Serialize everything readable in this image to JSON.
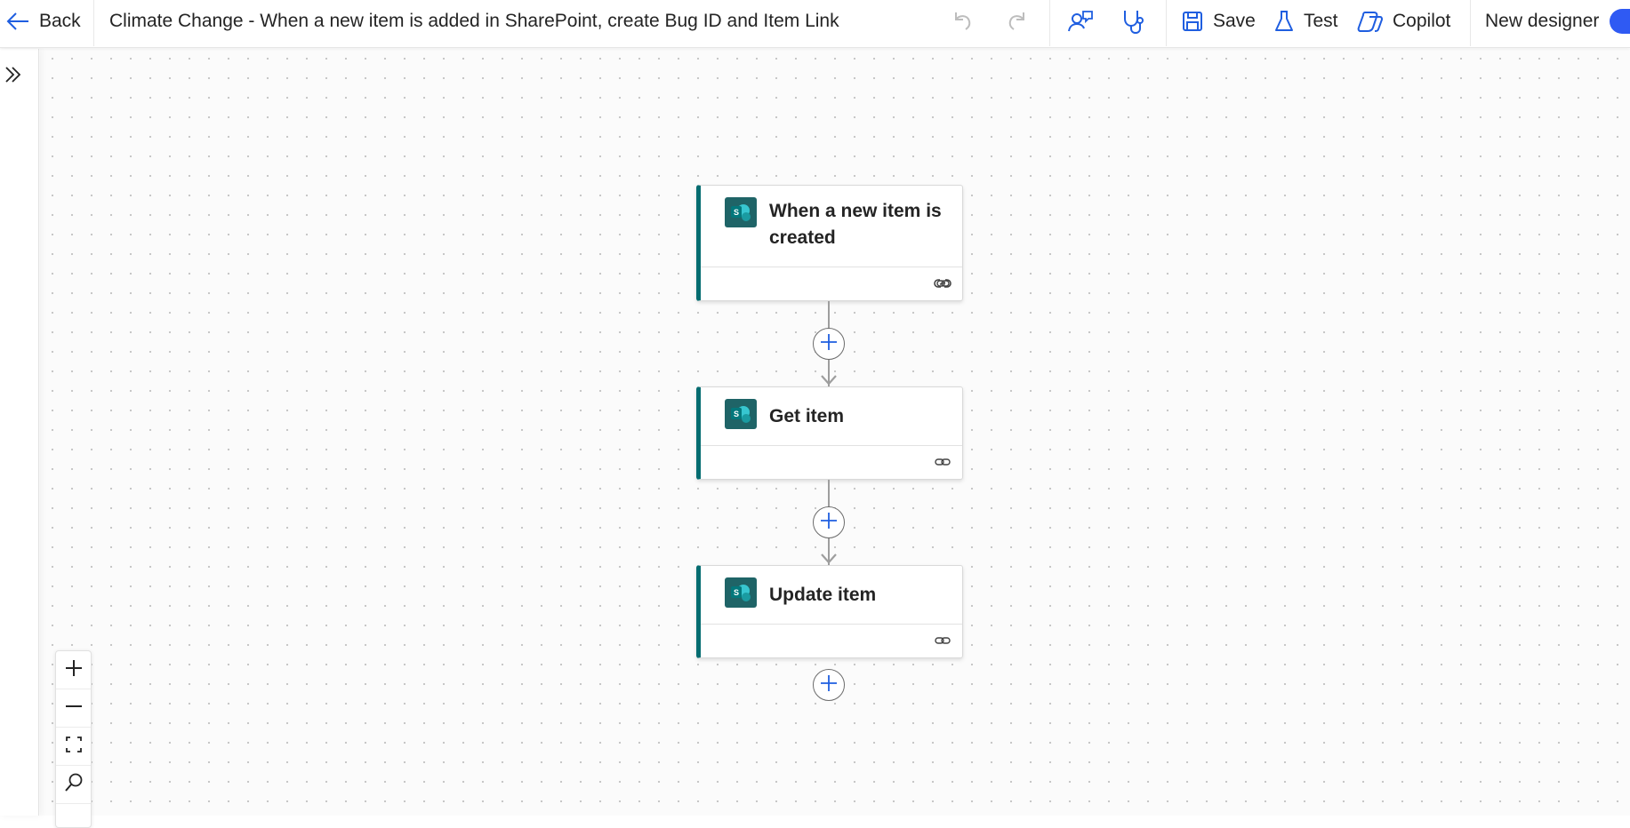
{
  "topbar": {
    "back_label": "Back",
    "flow_title": "Climate Change - When a new item is added in SharePoint, create Bug ID and Item Link",
    "save_label": "Save",
    "test_label": "Test",
    "copilot_label": "Copilot",
    "new_designer_label": "New designer",
    "new_designer_toggle_on": true
  },
  "flow": {
    "steps": [
      {
        "title": "When a new item is created",
        "connector": "SharePoint",
        "icon": "sharepoint-icon"
      },
      {
        "title": "Get item",
        "connector": "SharePoint",
        "icon": "sharepoint-icon"
      },
      {
        "title": "Update item",
        "connector": "SharePoint",
        "icon": "sharepoint-icon"
      }
    ]
  },
  "zoom": {
    "controls": [
      "zoom-in",
      "zoom-out",
      "fit-view",
      "search"
    ]
  },
  "colors": {
    "accent": "#036c70",
    "primary_blue": "#2f5af3",
    "icon_blue": "#1f5ee0",
    "sharepoint_tile": "#1f6467"
  }
}
